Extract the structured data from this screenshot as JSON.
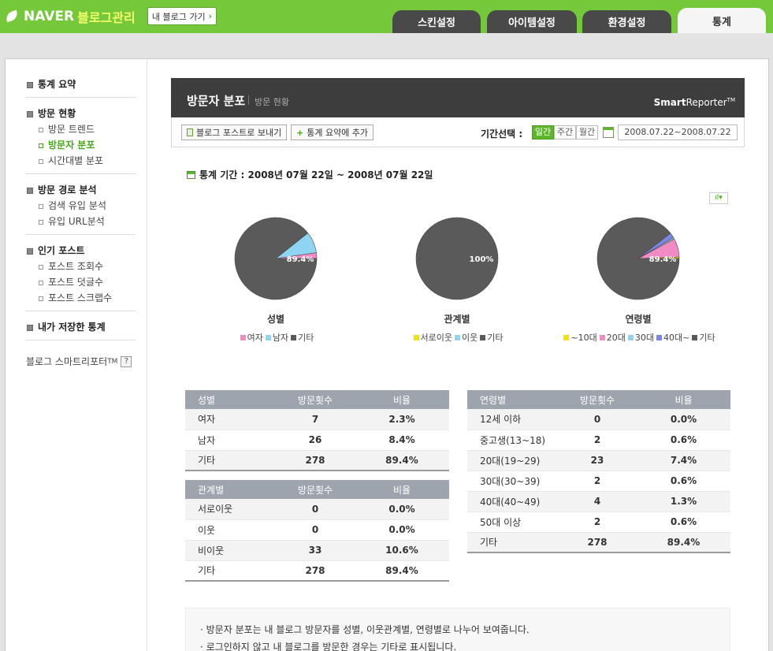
{
  "header": {
    "brand": "NAVER",
    "app_title": "블로그관리",
    "my_blog_button": "내 블로그 가기",
    "tabs": [
      "스킨설정",
      "아이템설정",
      "환경설정",
      "통계"
    ],
    "active_tab": "통계"
  },
  "sidebar": {
    "groups": [
      {
        "title": "통계 요약",
        "items": []
      },
      {
        "title": "방문 현황",
        "items": [
          "방문 트렌드",
          "방문자 분포",
          "시간대별 분포"
        ]
      },
      {
        "title": "방문 경로 분석",
        "items": [
          "검색 유입 분석",
          "유입 URL분석"
        ]
      },
      {
        "title": "인기 포스트",
        "items": [
          "포스트 조회수",
          "포스트 덧글수",
          "포스트 스크랩수"
        ]
      },
      {
        "title": "내가 저장한 통계",
        "items": []
      }
    ],
    "active_item": "방문자 분포",
    "smartreporter_link": "블로그 스마트리포터",
    "tm": "TM",
    "help_label": "?"
  },
  "content": {
    "title": "방문자 분포",
    "subtitle": "방문 현황",
    "brand_bold": "Smart",
    "brand_rest": "Reporter",
    "brand_tm": "TM",
    "toolbar": {
      "send_post": "블로그 포스트로 보내기",
      "add_summary": "통계 요약에 추가",
      "period_label": "기간선택 :",
      "period_options": [
        "일간",
        "주간",
        "월간"
      ],
      "active_period": "일간",
      "date_range": "2008.07.22~2008.07.22"
    },
    "stat_period": "통계 기간 : 2008년 07월 22일 ~ 2008년 07월 22일",
    "chart_toggle": "ıl▾"
  },
  "chart_data": [
    {
      "type": "pie",
      "title": "성별",
      "categories": [
        "여자",
        "남자",
        "기타"
      ],
      "values": [
        2.3,
        8.4,
        89.4
      ],
      "colors": [
        "#f28ac4",
        "#8fd4f2",
        "#5a5a5a"
      ],
      "label": "89.4%"
    },
    {
      "type": "pie",
      "title": "관계별",
      "categories": [
        "서로이웃",
        "이웃",
        "기타"
      ],
      "values": [
        0,
        0,
        100
      ],
      "colors": [
        "#f2e200",
        "#8fd4f2",
        "#5a5a5a"
      ],
      "label": "100%"
    },
    {
      "type": "pie",
      "title": "연령별",
      "categories": [
        "~10대",
        "20대",
        "30대",
        "40대~",
        "기타"
      ],
      "values": [
        0.6,
        7.4,
        0.6,
        2.0,
        89.4
      ],
      "colors": [
        "#f2e200",
        "#f28ac4",
        "#8fd4f2",
        "#7d86e6",
        "#5a5a5a"
      ],
      "label": "89.4%"
    }
  ],
  "tables": {
    "gender": {
      "headers": [
        "성별",
        "방문횟수",
        "비율"
      ],
      "rows": [
        [
          "여자",
          "7",
          "2.3%"
        ],
        [
          "남자",
          "26",
          "8.4%"
        ],
        [
          "기타",
          "278",
          "89.4%"
        ]
      ]
    },
    "relation": {
      "headers": [
        "관계별",
        "방문횟수",
        "비율"
      ],
      "rows": [
        [
          "서로이웃",
          "0",
          "0.0%"
        ],
        [
          "이웃",
          "0",
          "0.0%"
        ],
        [
          "비이웃",
          "33",
          "10.6%"
        ],
        [
          "기타",
          "278",
          "89.4%"
        ]
      ]
    },
    "age": {
      "headers": [
        "연령별",
        "방문횟수",
        "비율"
      ],
      "rows": [
        [
          "12세 이하",
          "0",
          "0.0%"
        ],
        [
          "중고생(13~18)",
          "2",
          "0.6%"
        ],
        [
          "20대(19~29)",
          "23",
          "7.4%"
        ],
        [
          "30대(30~39)",
          "2",
          "0.6%"
        ],
        [
          "40대(40~49)",
          "4",
          "1.3%"
        ],
        [
          "50대 이상",
          "2",
          "0.6%"
        ],
        [
          "기타",
          "278",
          "89.4%"
        ]
      ]
    }
  },
  "notice": [
    "· 방문자 분포는 내 블로그 방문자를 성별, 이웃관계별, 연령별로 나누어 보여줍니다.",
    "· 로그인하지 않고 내 블로그를 방문한 경우는 기타로 표시됩니다."
  ]
}
